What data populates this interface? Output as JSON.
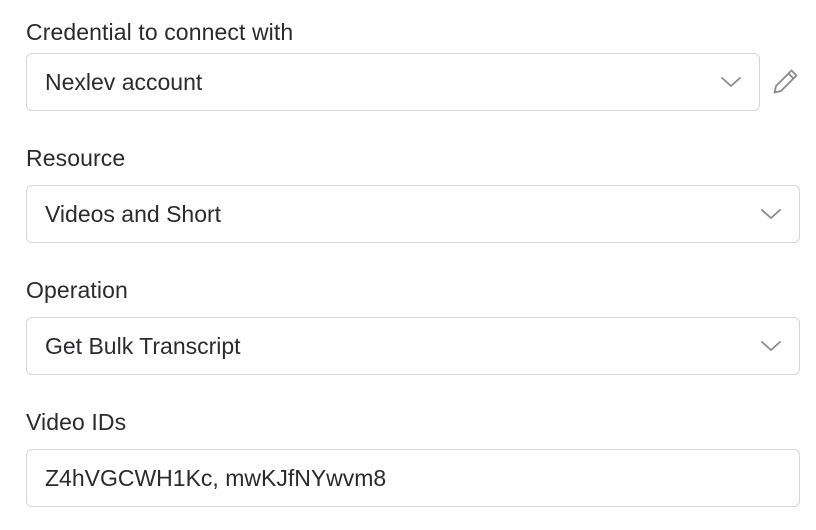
{
  "credential": {
    "label": "Credential to connect with",
    "value": "Nexlev account",
    "icon": "chevron-down-icon",
    "edit_icon": "pencil-icon"
  },
  "resource": {
    "label": "Resource",
    "value": "Videos and Short",
    "icon": "chevron-down-icon"
  },
  "operation": {
    "label": "Operation",
    "value": "Get Bulk Transcript",
    "icon": "chevron-down-icon"
  },
  "video_ids": {
    "label": "Video IDs",
    "value": "Z4hVGCWH1Kc, mwKJfNYwvm8"
  },
  "colors": {
    "text": "#2b2b2f",
    "border": "#d6d6db",
    "icon": "#8a8a90"
  }
}
